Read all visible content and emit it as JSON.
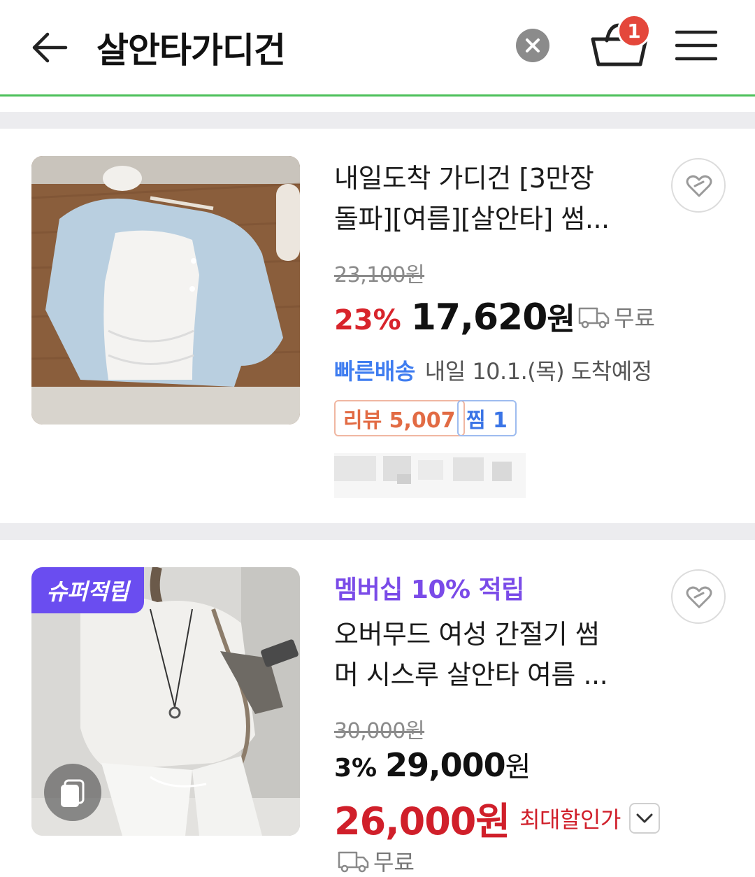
{
  "header": {
    "query": "살안타가디건",
    "cart_count": "1",
    "accent_line_color": "#4cc05a"
  },
  "products": [
    {
      "title_line1": "내일도착 가디건 [3만장",
      "title_line2": "돌파][여름][살안타] 썸...",
      "original_price": "23,100원",
      "discount": "23%",
      "price_number": "17,620",
      "price_unit": "원",
      "shipping": "무료",
      "delivery_fast": "빠른배송",
      "delivery_text": "내일 10.1.(목) 도착예정",
      "review_tag": "리뷰 5,007",
      "wish_tag": "찜 1",
      "image": "light blue cardigan with white lace top on wooden table"
    },
    {
      "badge": "슈퍼적립",
      "membership": "멤버십 10% 적립",
      "title_line1": "오버무드 여성 간절기 썸",
      "title_line2": "머 시스루 살안타 여름 ...",
      "original_price": "30,000원",
      "discount": "3%",
      "price_number": "29,000",
      "price_unit": "원",
      "max_discount_price": "26,000원",
      "max_discount_label": "최대할인가",
      "shipping": "무료",
      "image": "woman in white see-through knit top and white pants"
    }
  ],
  "icons": [
    "back-arrow-icon",
    "clear-icon",
    "cart-icon",
    "menu-icon",
    "heart-icon",
    "truck-icon",
    "album-icon",
    "chevron-down-icon"
  ]
}
